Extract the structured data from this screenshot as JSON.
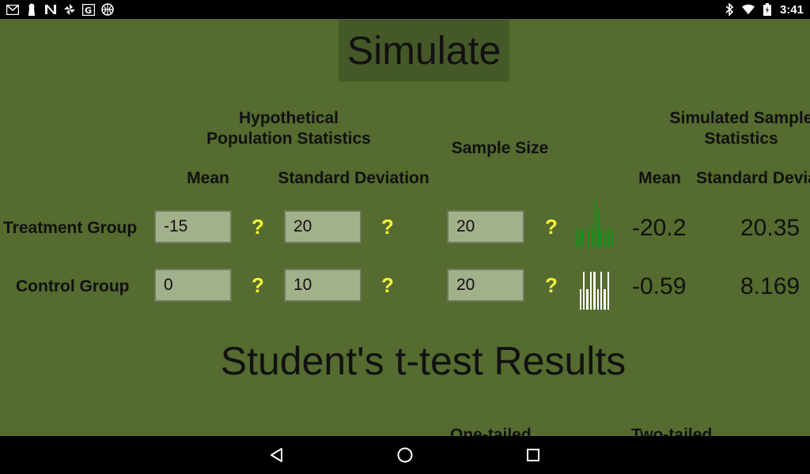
{
  "status_bar": {
    "time": "3:41",
    "left_icons": [
      "gmail-icon",
      "keyhole-icon",
      "n-app-icon",
      "pinwheel-icon",
      "google-icon",
      "basketball-icon"
    ],
    "right_icons": [
      "bluetooth-icon",
      "wifi-icon",
      "battery-icon"
    ]
  },
  "simulate_button": {
    "label": "Simulate"
  },
  "headers": {
    "hypothetical_line1": "Hypothetical",
    "hypothetical_line2": "Population Statistics",
    "sample_size": "Sample Size",
    "simulated_line1": "Simulated Sample",
    "simulated_line2": "Statistics",
    "mean": "Mean",
    "std_dev": "Standard Deviation",
    "sim_mean": "Mean",
    "sim_std_dev": "Standard Deviation"
  },
  "rows": [
    {
      "label": "Treatment Group",
      "mean": "-15",
      "std_dev": "20",
      "sample_size": "20",
      "sim_mean": "-20.2",
      "sim_std_dev": "20.35",
      "hist_color": "#1e8c1e"
    },
    {
      "label": "Control Group",
      "mean": "0",
      "std_dev": "10",
      "sample_size": "20",
      "sim_mean": "-0.59",
      "sim_std_dev": "8.169",
      "hist_color": "#ffffff"
    }
  ],
  "help_glyph": "?",
  "ttest": {
    "title": "Student's t-test Results",
    "one_tailed": "One-tailed",
    "two_tailed": "Two-tailed"
  },
  "colors": {
    "background": "#556b2f",
    "simulate_bg": "#455827",
    "field_bg": "#a3b08c",
    "help": "#f5f53a"
  }
}
